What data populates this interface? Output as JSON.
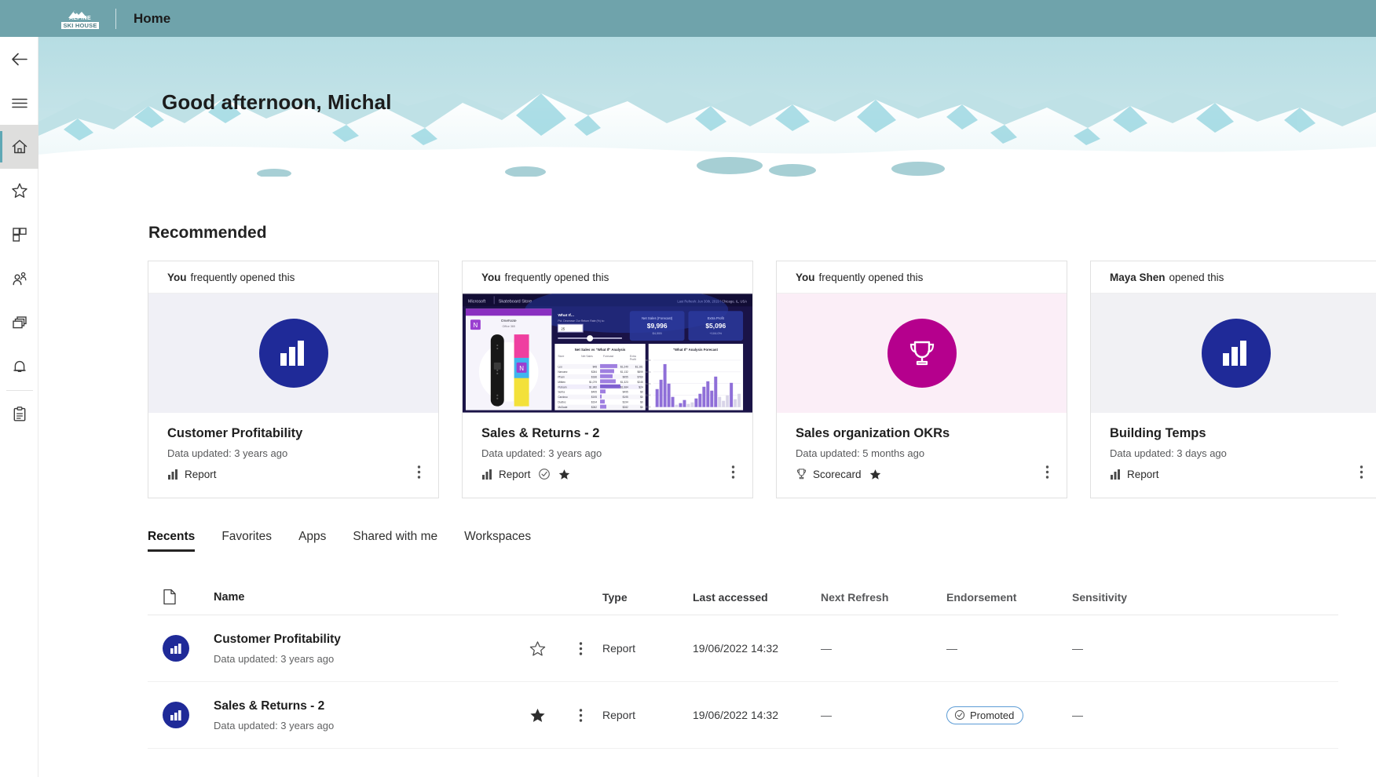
{
  "topbar": {
    "logo_alt": "Alpine Ski House",
    "logo_line1": "ALPINE",
    "logo_line2": "SKI HOUSE",
    "title": "Home"
  },
  "rail": {
    "items": [
      {
        "name": "back",
        "icon": "arrow-left-icon",
        "label": "Back"
      },
      {
        "name": "menu",
        "icon": "hamburger-icon",
        "label": "Navigation"
      },
      {
        "name": "home",
        "icon": "home-icon",
        "label": "Home"
      },
      {
        "name": "favorites",
        "icon": "star-icon",
        "label": "Favorites"
      },
      {
        "name": "apps",
        "icon": "apps-grid-icon",
        "label": "Apps"
      },
      {
        "name": "shared",
        "icon": "people-icon",
        "label": "Shared with me"
      },
      {
        "name": "workspaces",
        "icon": "workspaces-icon",
        "label": "Workspaces"
      },
      {
        "name": "notifications",
        "icon": "bell-icon",
        "label": "Notifications"
      },
      {
        "name": "metrics",
        "icon": "clipboard-icon",
        "label": "Metrics"
      }
    ],
    "selected": "home"
  },
  "banner": {
    "greeting": "Good afternoon, Michal"
  },
  "recommended": {
    "title": "Recommended",
    "cards": [
      {
        "actor": "You",
        "reason": "frequently opened this",
        "thumb": "report-icon-tile",
        "thumb_bg": "blue",
        "circle_color": "#1f2a98",
        "title": "Customer Profitability",
        "subtitle": "Data updated: 3 years ago",
        "type": "Report",
        "type_icon": "bar-chart-icon",
        "certified": false,
        "favorite": false
      },
      {
        "actor": "You",
        "reason": "frequently opened this",
        "thumb": "report-preview",
        "thumb_bg": "preview",
        "circle_color": "",
        "title": "Sales & Returns  - 2",
        "subtitle": "Data updated: 3 years ago",
        "type": "Report",
        "type_icon": "bar-chart-icon",
        "certified": true,
        "favorite": true,
        "preview": {
          "brand": "Microsoft",
          "store": "Skateboard Store",
          "refresh": "Last Refresh: Jun 30th, 2019 / Chicago, IL, USA",
          "panel_title": "What If...",
          "panel_sub": "Pct. Decrease Our Return Rate (%) to:",
          "input_value": "25",
          "kpi1_label": "Net Sales (Forecast)",
          "kpi1_value": "$9,996",
          "kpi1_sub": "$4,555",
          "kpi2_label": "Extra Profit",
          "kpi2_value": "$5,096",
          "kpi2_sub": "+104.0%",
          "table_title": "Net Sales vs \"What If\" Analysis",
          "chart_title": "\"What If\" Analysis Forecast",
          "product_label": "OneNote",
          "product_sub": "Office 365"
        }
      },
      {
        "actor": "You",
        "reason": "frequently opened this",
        "thumb": "trophy-icon-tile",
        "thumb_bg": "pink",
        "circle_color": "#b5008d",
        "title": "Sales organization OKRs",
        "subtitle": "Data updated: 5 months ago",
        "type": "Scorecard",
        "type_icon": "trophy-icon",
        "certified": false,
        "favorite": true
      },
      {
        "actor": "Maya Shen",
        "reason": "opened this",
        "thumb": "report-icon-tile",
        "thumb_bg": "grey",
        "circle_color": "#1f2a98",
        "title": "Building Temps",
        "subtitle": "Data updated: 3 days ago",
        "type": "Report",
        "type_icon": "bar-chart-icon",
        "certified": false,
        "favorite": false
      }
    ]
  },
  "tabs": {
    "items": [
      {
        "label": "Recents",
        "active": true
      },
      {
        "label": "Favorites",
        "active": false
      },
      {
        "label": "Apps",
        "active": false
      },
      {
        "label": "Shared with me",
        "active": false
      },
      {
        "label": "Workspaces",
        "active": false
      }
    ]
  },
  "table": {
    "columns": {
      "icon": "",
      "name": "Name",
      "type": "Type",
      "last_accessed": "Last accessed",
      "next_refresh": "Next Refresh",
      "endorsement": "Endorsement",
      "sensitivity": "Sensitivity"
    },
    "rows": [
      {
        "icon": "report-icon",
        "title": "Customer Profitability",
        "subtitle": "Data updated: 3 years ago",
        "favorite": false,
        "type": "Report",
        "last_accessed": "19/06/2022 14:32",
        "next_refresh": "—",
        "endorsement": "—",
        "endorsement_badge": false,
        "sensitivity": "—"
      },
      {
        "icon": "report-icon",
        "title": "Sales & Returns  - 2",
        "subtitle": "Data updated: 3 years ago",
        "favorite": true,
        "type": "Report",
        "last_accessed": "19/06/2022 14:32",
        "next_refresh": "—",
        "endorsement": "Promoted",
        "endorsement_badge": true,
        "sensitivity": "—"
      }
    ]
  },
  "colors": {
    "topbar": "#6fa3ab",
    "accent_blue": "#1f2a98",
    "accent_magenta": "#b5008d",
    "badge_border": "#5b9bd5",
    "rail_selected": "#dededd"
  }
}
